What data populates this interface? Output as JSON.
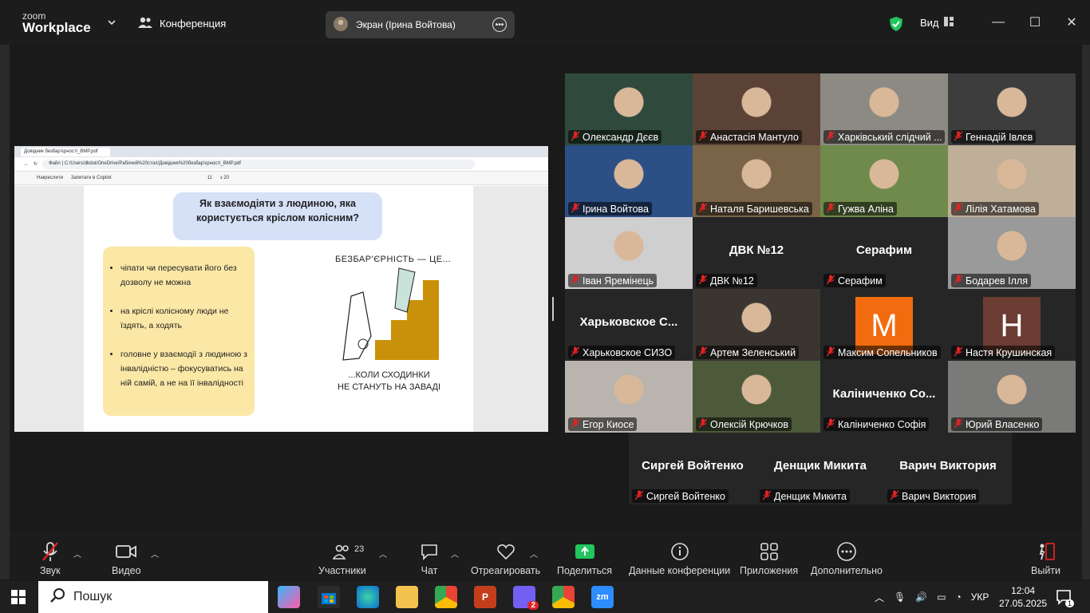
{
  "app": {
    "logo_line1": "zoom",
    "logo_line2": "Workplace",
    "meeting_label": "Конференция",
    "screen_label": "Экран (Ірина Войтова)",
    "view_label": "Вид"
  },
  "shared": {
    "tab_title": "Довідник безбар'єрності_BMP.pdf",
    "url_prefix": "Файл",
    "url": "C:/Users/dbdut/OneDrive/Рабочий%20стол/Довідник%20безбар'єрності_BMP.pdf",
    "tool_draw": "Накреслити",
    "tool_copilot": "Запитати в Copilot",
    "page_num": "11",
    "page_total": "з 20",
    "title": "Як взаємодіяти з людиною, яка користується кріслом колісним?",
    "bullets": [
      "чіпати чи пересувати його без дозволу не можна",
      "на кріслі колісному люди не їздять, а ходять",
      "головне у взаємодії з людиною з інвалідністю – фокусуватись на ній самій, а не на її інвалідності"
    ],
    "hand_top": "БЕЗБАР'ЄРНІСТЬ — ЦЕ...",
    "hand_bottom1": "...КОЛИ СХОДИНКИ",
    "hand_bottom2": "НЕ СТАНУТЬ НА ЗАВАДІ"
  },
  "participants": [
    {
      "name": "Олександр Дєєв",
      "type": "video",
      "color": "#2f4a3c"
    },
    {
      "name": "Анастасія Мантуло",
      "type": "video",
      "color": "#5a4336"
    },
    {
      "name": "Харківський слідчий ...",
      "type": "video",
      "color": "#8d8a84"
    },
    {
      "name": "Геннадій Івлєв",
      "type": "video",
      "color": "#3d3d3d"
    },
    {
      "name": "Ірина Войтова",
      "type": "video",
      "color": "#2c4f86"
    },
    {
      "name": "Наталя Баришевська",
      "type": "video",
      "color": "#7a6448"
    },
    {
      "name": "Гужва Аліна",
      "type": "video",
      "color": "#6f8a4a"
    },
    {
      "name": "Лілія Хатамова",
      "type": "video",
      "color": "#bfae98"
    },
    {
      "name": "Іван Яремінець",
      "type": "video",
      "color": "#cfcfcf"
    },
    {
      "name": "ДВК №12",
      "type": "text",
      "big": "ДВК №12"
    },
    {
      "name": "Серафим",
      "type": "text",
      "big": "Серафим"
    },
    {
      "name": "Бодарев Ілля",
      "type": "video",
      "color": "#9a9a9a"
    },
    {
      "name": "Харьковское СИЗО",
      "type": "text",
      "big": "Харьковское С..."
    },
    {
      "name": "Артем Зеленський",
      "type": "video",
      "color": "#3a3530"
    },
    {
      "name": "Максим Сопельников",
      "type": "avatar",
      "letter": "M",
      "color": "#f26b0f"
    },
    {
      "name": "Настя Крушинская",
      "type": "avatar",
      "letter": "H",
      "color": "#6b3d33"
    },
    {
      "name": "Егор Киосе",
      "type": "video",
      "color": "#b9b4ad"
    },
    {
      "name": "Олексій Крючков",
      "type": "video",
      "color": "#4d5a3a"
    },
    {
      "name": "Каліниченко Софія",
      "type": "text",
      "big": "Каліниченко Со..."
    },
    {
      "name": "Юрий Власенко",
      "type": "video",
      "color": "#7a7a78"
    },
    {
      "name": "Сиргей Войтенко",
      "type": "text",
      "big": "Сиргей Войтенко"
    },
    {
      "name": "Денщик Микита",
      "type": "text",
      "big": "Денщик Микита"
    },
    {
      "name": "Варич Виктория",
      "type": "text",
      "big": "Варич Виктория"
    }
  ],
  "toolbar": {
    "audio": "Звук",
    "video": "Видео",
    "participants": "Участники",
    "participants_count": "23",
    "chat": "Чат",
    "react": "Отреагировать",
    "share": "Поделиться",
    "info": "Данные конференции",
    "apps": "Приложения",
    "more": "Дополнительно",
    "leave": "Выйти"
  },
  "taskbar": {
    "search": "Пошук",
    "lang": "УКР",
    "time": "12:04",
    "date": "27.05.2025",
    "viber_badge": "2",
    "notif_badge": "1"
  },
  "colors": {
    "accent_green": "#22c55e",
    "share_green": "#22c55e",
    "mic_red": "#e02424"
  }
}
